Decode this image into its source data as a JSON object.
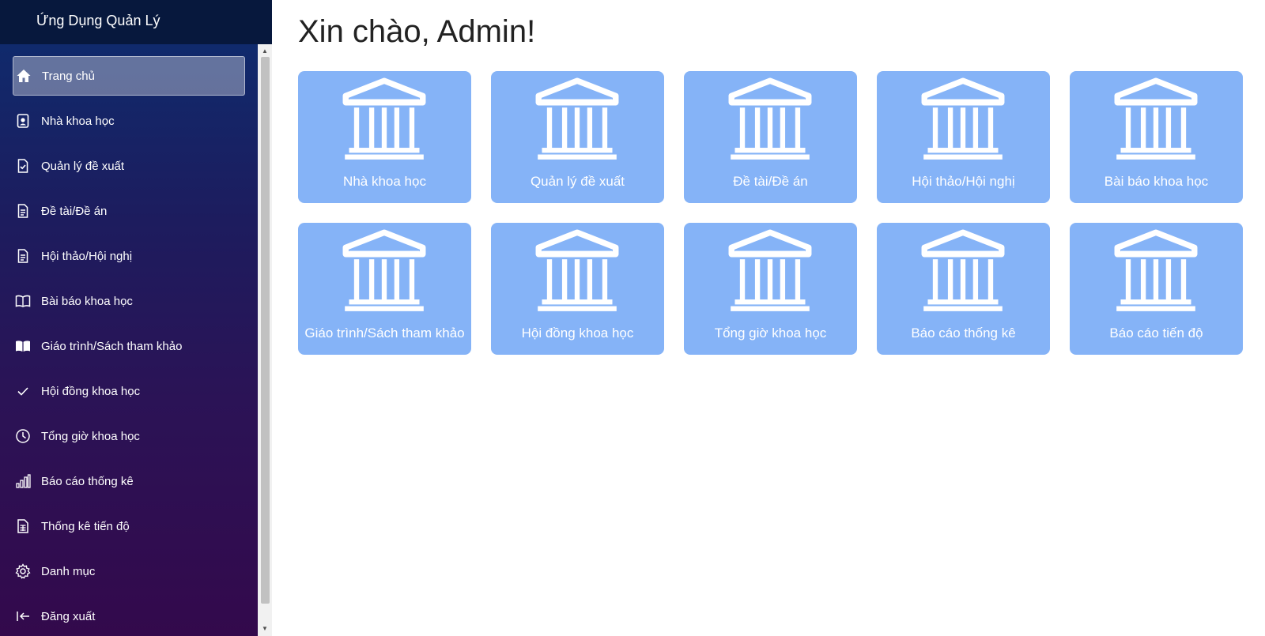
{
  "app": {
    "title": "Ứng Dụng Quản Lý"
  },
  "sidebar": {
    "items": [
      {
        "label": "Trang chủ",
        "icon": "home-icon",
        "active": true
      },
      {
        "label": "Nhà khoa học",
        "icon": "person-badge-icon"
      },
      {
        "label": "Quản lý đề xuất",
        "icon": "file-check-icon"
      },
      {
        "label": "Đề tài/Đề án",
        "icon": "file-text-icon"
      },
      {
        "label": "Hội thảo/Hội nghị",
        "icon": "file-text-icon"
      },
      {
        "label": "Bài báo khoa học",
        "icon": "book-open-icon"
      },
      {
        "label": "Giáo trình/Sách tham khảo",
        "icon": "book-filled-icon"
      },
      {
        "label": "Hội đồng khoa học",
        "icon": "check-icon"
      },
      {
        "label": "Tổng giờ khoa học",
        "icon": "clock-icon"
      },
      {
        "label": "Báo cáo thống kê",
        "icon": "bar-chart-icon"
      },
      {
        "label": "Thống kê tiến độ",
        "icon": "spreadsheet-icon"
      },
      {
        "label": "Danh mục",
        "icon": "gear-icon"
      },
      {
        "label": "Đăng xuất",
        "icon": "logout-arrow-icon"
      }
    ]
  },
  "main": {
    "greeting": "Xin chào, Admin!",
    "cards": [
      {
        "label": "Nhà khoa học",
        "icon": "bank-building-icon"
      },
      {
        "label": "Quản lý đề xuất",
        "icon": "bank-building-icon"
      },
      {
        "label": "Đề tài/Đề án",
        "icon": "bank-building-icon"
      },
      {
        "label": "Hội thảo/Hội nghị",
        "icon": "bank-building-icon"
      },
      {
        "label": "Bài báo khoa học",
        "icon": "bank-building-icon"
      },
      {
        "label": "Giáo trình/Sách tham khảo",
        "icon": "bank-building-icon"
      },
      {
        "label": "Hội đồng khoa học",
        "icon": "bank-building-icon"
      },
      {
        "label": "Tổng giờ khoa học",
        "icon": "bank-building-icon"
      },
      {
        "label": "Báo cáo thống kê",
        "icon": "bank-building-icon"
      },
      {
        "label": "Báo cáo tiến độ",
        "icon": "bank-building-icon"
      }
    ]
  },
  "colors": {
    "sidebar_top": "#102a6c",
    "sidebar_bottom": "#33094c",
    "brand_bar": "#07183d",
    "card": "#85b3f7"
  }
}
